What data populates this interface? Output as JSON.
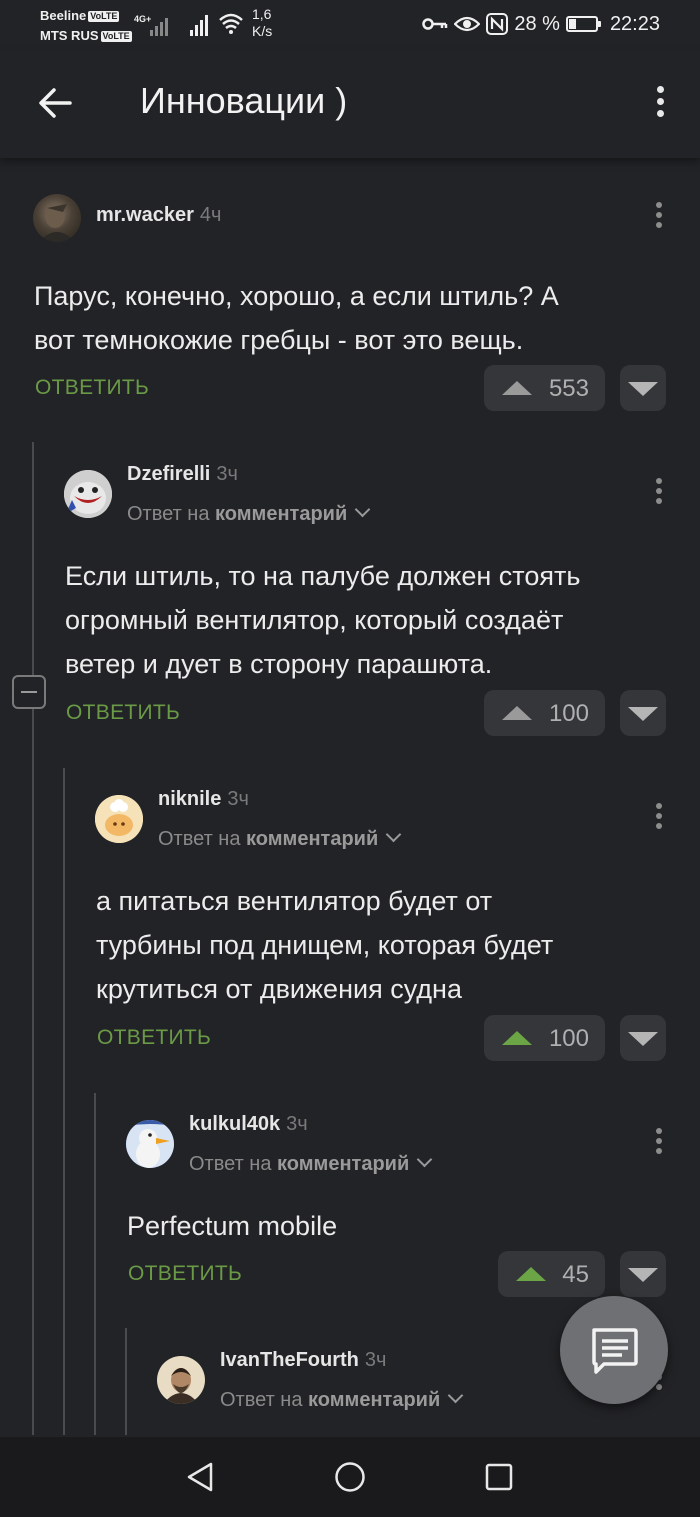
{
  "status_bar": {
    "carrier1": "Beeline",
    "carrier2": "MTS RUS",
    "volte": "VoLTE",
    "network_type": "4G+",
    "speed_value": "1,6",
    "speed_unit": "K/s",
    "battery_percent": "28 %",
    "battery_level": 0.28,
    "time": "22:23"
  },
  "header": {
    "title": "Инновации )"
  },
  "colors": {
    "background": "#222326",
    "reply_green": "#6b9a47",
    "upvote_green": "#6ba545"
  },
  "comments": [
    {
      "author": "mr.wacker",
      "time": "4ч",
      "reply_prefix": "",
      "reply_target": "",
      "lines": [
        "Парус, конечно, хорошо, а если штиль? А",
        "вот темнокожие гребцы - вот это вещь."
      ],
      "reply_label": "ОТВЕТИТЬ",
      "votes": "553",
      "upvoted": false
    },
    {
      "author": "Dzefirelli",
      "time": "3ч",
      "reply_prefix": "Ответ на",
      "reply_target": "комментарий",
      "lines": [
        "Если штиль, то на палубе должен стоять",
        "огромный вентилятор, который создаёт",
        "ветер и дует в сторону парашюта."
      ],
      "reply_label": "ОТВЕТИТЬ",
      "votes": "100",
      "upvoted": false
    },
    {
      "author": "niknile",
      "time": "3ч",
      "reply_prefix": "Ответ на",
      "reply_target": "комментарий",
      "lines": [
        "а питаться вентилятор будет от",
        "турбины под днищем, которая будет",
        "крутиться от движения судна"
      ],
      "reply_label": "ОТВЕТИТЬ",
      "votes": "100",
      "upvoted": true
    },
    {
      "author": "kulkul40k",
      "time": "3ч",
      "reply_prefix": "Ответ на",
      "reply_target": "комментарий",
      "lines": [
        "Perfectum mobile"
      ],
      "reply_label": "ОТВЕТИТЬ",
      "votes": "45",
      "upvoted": true
    },
    {
      "author": "IvanTheFourth",
      "time": "3ч",
      "reply_prefix": "Ответ на",
      "reply_target": "комментарий",
      "lines": [],
      "reply_label": "",
      "votes": "",
      "upvoted": false
    }
  ],
  "icons": {
    "back": "arrow-left-icon",
    "menu": "more-vertical-icon",
    "collapse": "minus-square-icon",
    "fab": "comment-icon",
    "nav_back": "triangle-back-icon",
    "nav_home": "circle-home-icon",
    "nav_recent": "square-recent-icon"
  }
}
